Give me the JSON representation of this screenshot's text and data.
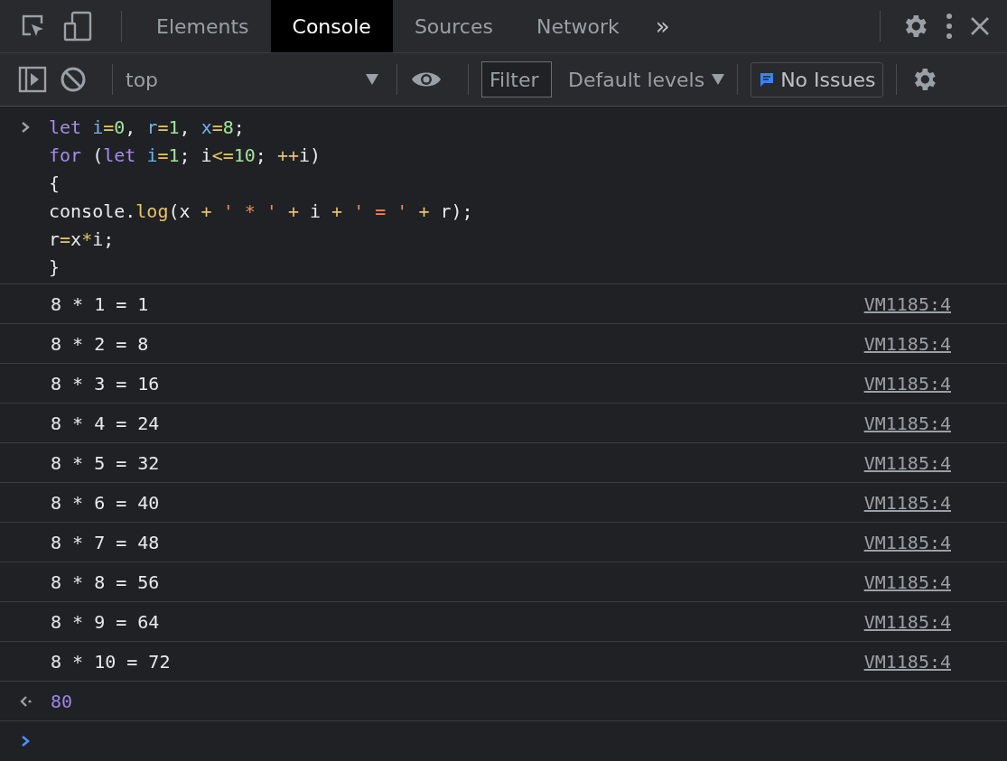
{
  "tabs": [
    {
      "label": "Elements",
      "selected": false
    },
    {
      "label": "Console",
      "selected": true
    },
    {
      "label": "Sources",
      "selected": false
    },
    {
      "label": "Network",
      "selected": false
    }
  ],
  "more_tabs": "»",
  "toolbar": {
    "context": "top",
    "filter": {
      "placeholder": "Filter"
    },
    "levels": "Default levels",
    "issues": "No Issues"
  },
  "input": [
    [
      {
        "kind": "keyword",
        "text": "let "
      },
      {
        "kind": "variable",
        "text": "i"
      },
      {
        "kind": "operator",
        "text": "="
      },
      {
        "kind": "number",
        "text": "0"
      },
      {
        "kind": "plain",
        "text": ", "
      },
      {
        "kind": "variable",
        "text": "r"
      },
      {
        "kind": "operator",
        "text": "="
      },
      {
        "kind": "number",
        "text": "1"
      },
      {
        "kind": "plain",
        "text": ", "
      },
      {
        "kind": "variable",
        "text": "x"
      },
      {
        "kind": "operator",
        "text": "="
      },
      {
        "kind": "number",
        "text": "8"
      },
      {
        "kind": "plain",
        "text": ";"
      }
    ],
    [
      {
        "kind": "keyword",
        "text": "for"
      },
      {
        "kind": "plain",
        "text": " ("
      },
      {
        "kind": "keyword",
        "text": "let "
      },
      {
        "kind": "variable",
        "text": "i"
      },
      {
        "kind": "operator",
        "text": "="
      },
      {
        "kind": "number",
        "text": "1"
      },
      {
        "kind": "plain",
        "text": "; i"
      },
      {
        "kind": "operator",
        "text": "<="
      },
      {
        "kind": "number",
        "text": "10"
      },
      {
        "kind": "plain",
        "text": "; "
      },
      {
        "kind": "operator",
        "text": "++"
      },
      {
        "kind": "plain",
        "text": "i)"
      }
    ],
    [
      {
        "kind": "plain",
        "text": "{"
      }
    ],
    [
      {
        "kind": "plain",
        "text": "console."
      },
      {
        "kind": "function",
        "text": "log"
      },
      {
        "kind": "plain",
        "text": "(x "
      },
      {
        "kind": "operator",
        "text": "+ "
      },
      {
        "kind": "string",
        "text": "' * ' "
      },
      {
        "kind": "operator",
        "text": "+"
      },
      {
        "kind": "plain",
        "text": " i "
      },
      {
        "kind": "operator",
        "text": "+ "
      },
      {
        "kind": "string",
        "text": "' = ' "
      },
      {
        "kind": "operator",
        "text": "+"
      },
      {
        "kind": "plain",
        "text": " r);"
      }
    ],
    [
      {
        "kind": "plain",
        "text": "r"
      },
      {
        "kind": "operator",
        "text": "="
      },
      {
        "kind": "plain",
        "text": "x"
      },
      {
        "kind": "operator",
        "text": "*"
      },
      {
        "kind": "plain",
        "text": "i;"
      }
    ],
    [
      {
        "kind": "plain",
        "text": "}"
      }
    ]
  ],
  "logs": [
    {
      "text": "8 * 1 = 1",
      "source": "VM1185:4"
    },
    {
      "text": "8 * 2 = 8",
      "source": "VM1185:4"
    },
    {
      "text": "8 * 3 = 16",
      "source": "VM1185:4"
    },
    {
      "text": "8 * 4 = 24",
      "source": "VM1185:4"
    },
    {
      "text": "8 * 5 = 32",
      "source": "VM1185:4"
    },
    {
      "text": "8 * 6 = 40",
      "source": "VM1185:4"
    },
    {
      "text": "8 * 7 = 48",
      "source": "VM1185:4"
    },
    {
      "text": "8 * 8 = 56",
      "source": "VM1185:4"
    },
    {
      "text": "8 * 9 = 64",
      "source": "VM1185:4"
    },
    {
      "text": "8 * 10 = 72",
      "source": "VM1185:4"
    }
  ],
  "result": "80"
}
